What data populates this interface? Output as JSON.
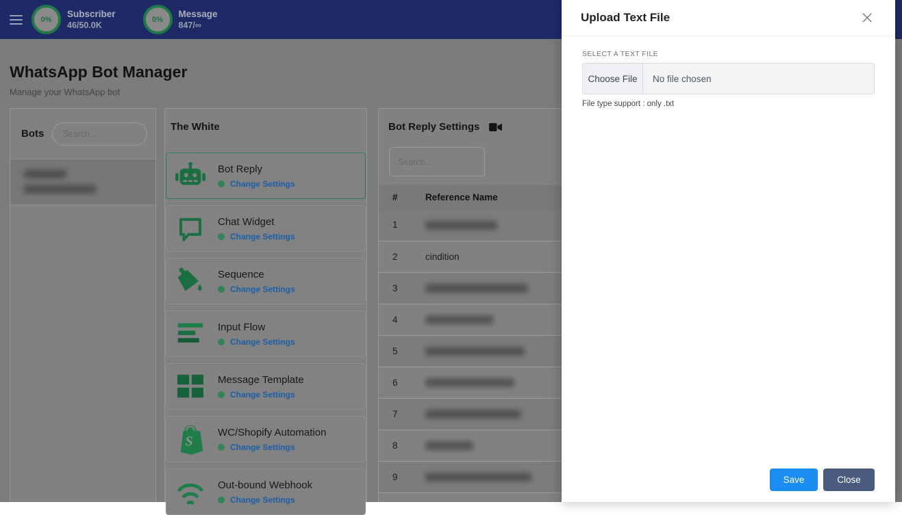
{
  "navbar": {
    "stats": [
      {
        "percent": "0%",
        "label": "Subscriber",
        "value": "46/50.0K"
      },
      {
        "percent": "0%",
        "label": "Message",
        "value": "847/∞"
      }
    ]
  },
  "page": {
    "title": "WhatsApp Bot Manager",
    "subtitle": "Manage your WhatsApp bot"
  },
  "bots_panel": {
    "title": "Bots",
    "search_placeholder": "Search...",
    "selected_bot_redacted": true
  },
  "bot_panel": {
    "title": "The White",
    "action_label": "Change Settings",
    "cards": [
      {
        "name": "Bot Reply",
        "icon": "robot-icon",
        "selected": true
      },
      {
        "name": "Chat Widget",
        "icon": "chat-bubble-icon"
      },
      {
        "name": "Sequence",
        "icon": "paint-bucket-icon"
      },
      {
        "name": "Input Flow",
        "icon": "bars-icon"
      },
      {
        "name": "Message Template",
        "icon": "grid-icon"
      },
      {
        "name": "WC/Shopify Automation",
        "icon": "shopify-bag-icon"
      },
      {
        "name": "Out-bound Webhook",
        "icon": "webhook-arcs-icon"
      }
    ]
  },
  "settings_panel": {
    "title": "Bot Reply Settings",
    "title_icon": "video-camera-icon",
    "search_placeholder": "Search...",
    "table": {
      "columns": [
        "#",
        "Reference Name"
      ],
      "rows": [
        {
          "num": "1",
          "name": "",
          "redacted": true
        },
        {
          "num": "2",
          "name": "cindition",
          "redacted": false
        },
        {
          "num": "3",
          "name": "",
          "redacted": true
        },
        {
          "num": "4",
          "name": "",
          "redacted": true
        },
        {
          "num": "5",
          "name": "",
          "redacted": true
        },
        {
          "num": "6",
          "name": "",
          "redacted": true
        },
        {
          "num": "7",
          "name": "",
          "redacted": true
        },
        {
          "num": "8",
          "name": "",
          "redacted": true
        },
        {
          "num": "9",
          "name": "",
          "redacted": true
        }
      ]
    }
  },
  "modal": {
    "title": "Upload Text File",
    "close_icon": "×",
    "select_label": "SELECT A TEXT FILE",
    "choose_file": "Choose File",
    "no_file": "No file chosen",
    "helper": "File type support : only .txt",
    "save": "Save",
    "close": "Close"
  },
  "colors": {
    "navbar_bg": "#1d2a66",
    "accent_green": "#1a6e3f",
    "link_blue": "#1a5fa8",
    "save_blue": "#1b8df2",
    "close_slate": "#4a5b7d"
  }
}
